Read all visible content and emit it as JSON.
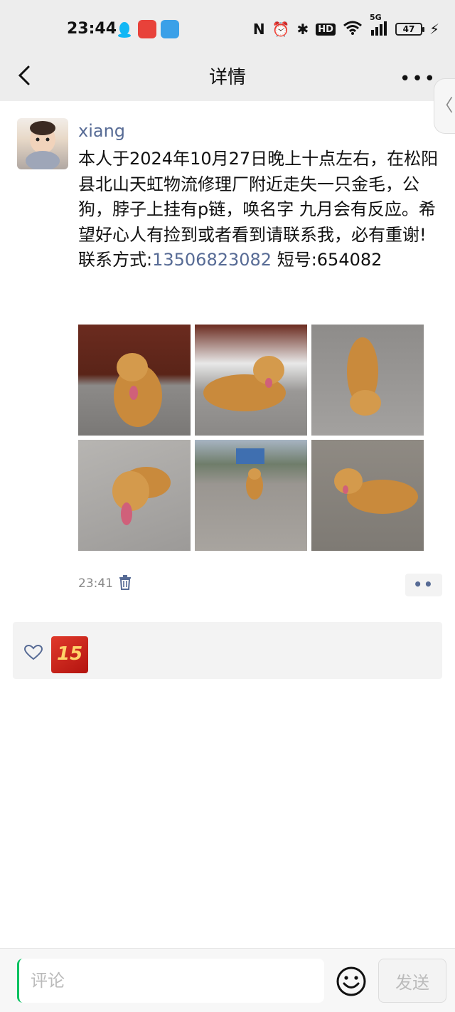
{
  "status_bar": {
    "time": "23:44",
    "signal_label": "5G",
    "battery": "47",
    "icons": [
      "qq-icon",
      "app-icon",
      "app-icon",
      "nfc-icon",
      "alarm-icon",
      "bluetooth-icon",
      "hd-icon",
      "wifi-icon",
      "signal-icon",
      "battery-icon",
      "charging-icon"
    ]
  },
  "nav": {
    "title": "详情",
    "back_icon": "chevron-left-icon",
    "more_icon": "more-icon",
    "more_label": "•••",
    "side_tab_label": "〈"
  },
  "post": {
    "username": "xiang",
    "text_before_phone": "本人于2024年10月27日晚上十点左右，在松阳县北山天虹物流修理厂附近走失一只金毛，公狗，脖子上挂有p链，唤名字 九月会有反应。希望好心人有捡到或者看到请联系我，必有重谢!\n联系方式:",
    "phone": "13506823082",
    "text_after_phone": " 短号:654082",
    "photo_count": 6,
    "time": "23:41",
    "more_label": "••"
  },
  "likes": {
    "liker_badge": "15"
  },
  "comment_bar": {
    "placeholder": "评论",
    "send_label": "发送"
  },
  "colors": {
    "link": "#576b95",
    "bar_bg": "#ededed",
    "likes_bg": "#f3f3f3",
    "accent_green": "#07c160"
  }
}
